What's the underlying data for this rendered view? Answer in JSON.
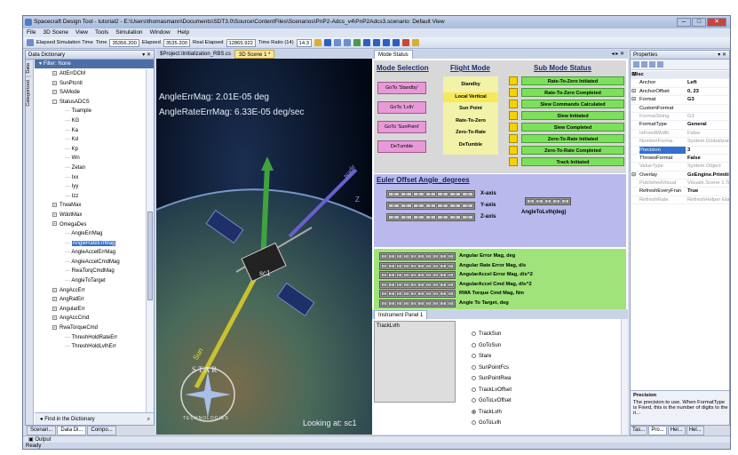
{
  "window": {
    "title": "Spacecraft Design Tool - tutorial2 - E:\\Users\\thomasmann\\Documents\\SDT3.0\\Source\\ContentFiles\\Scenarios\\PnP2-Adcs_v4\\PnP2Adcs3.scenario: Default View"
  },
  "menu": [
    "File",
    "3D Scene",
    "View",
    "Tools",
    "Simulation",
    "Window",
    "Help"
  ],
  "toolbar": {
    "elapsed_label": "Elapsed Simulation Time",
    "time_label": "Time",
    "time_value": "35356.200",
    "elapsed2_label": "Elapsed",
    "elapsed2_value": "3535.200",
    "real_label": "Real Elapsed",
    "real_value": "12865.922",
    "ratio_label": "Time Ratio (14)",
    "ratio_value": "14.3"
  },
  "data_dictionary": {
    "title": "Data Dictionary",
    "side_tabs": [
      "Data",
      "Categorized"
    ],
    "filter": "Filter: None",
    "items": [
      {
        "label": "AttErrDCM",
        "indent": 2,
        "pm": "+"
      },
      {
        "label": "SunPtcntl",
        "indent": 2,
        "pm": "+"
      },
      {
        "label": "SAMode",
        "indent": 2,
        "pm": "+"
      },
      {
        "label": "StatusADCS",
        "indent": 2,
        "pm": "-"
      },
      {
        "label": "Tsample",
        "indent": 3
      },
      {
        "label": "KG",
        "indent": 3
      },
      {
        "label": "Ka",
        "indent": 3
      },
      {
        "label": "Kd",
        "indent": 3
      },
      {
        "label": "Kp",
        "indent": 3
      },
      {
        "label": "Wn",
        "indent": 3
      },
      {
        "label": "Zetan",
        "indent": 3
      },
      {
        "label": "Ixx",
        "indent": 3
      },
      {
        "label": "Iyy",
        "indent": 3
      },
      {
        "label": "Izz",
        "indent": 3
      },
      {
        "label": "TrwaMax",
        "indent": 2,
        "pm": "+"
      },
      {
        "label": "WdotMax",
        "indent": 2,
        "pm": "+"
      },
      {
        "label": "OmegaDes",
        "indent": 2,
        "pm": "+"
      },
      {
        "label": "AngleErrMag",
        "indent": 3
      },
      {
        "label": "AngleRateErrMag",
        "indent": 3,
        "selected": true
      },
      {
        "label": "AngleAccelErrMag",
        "indent": 3
      },
      {
        "label": "AngleAccelCmdMag",
        "indent": 3
      },
      {
        "label": "RwaTorqCmdMag",
        "indent": 3
      },
      {
        "label": "AngleToTarget",
        "indent": 3
      },
      {
        "label": "AngAccErr",
        "indent": 2,
        "pm": "+"
      },
      {
        "label": "AngRatErr",
        "indent": 2,
        "pm": "+"
      },
      {
        "label": "AngularErr",
        "indent": 2,
        "pm": "+"
      },
      {
        "label": "AngAccCmd",
        "indent": 2,
        "pm": "+"
      },
      {
        "label": "RwaTorqueCmd",
        "indent": 2,
        "pm": "+"
      },
      {
        "label": "ThreshHoldRateErr",
        "indent": 3
      },
      {
        "label": "ThreshHoldLvlhErr",
        "indent": 3
      }
    ],
    "find_label": "Find in the Dictionary"
  },
  "doc_tabs": [
    "$Project.\\Initialization_RBS.cs",
    "3D Scene 1 *"
  ],
  "scene": {
    "angle_err": "AngleErrMag: 2.01E-05 deg",
    "angle_rate_err": "AngleRateErrMag: 6.33E-05 deg/sec",
    "looking_at": "Looking at: sc1",
    "label_sun": "Sun",
    "label_nadir": "Nadir",
    "logo_top": "STAR",
    "logo_bottom": "TECHNOLOGIES",
    "body_label": "sc1",
    "axis_z": "Z"
  },
  "mode_status": {
    "tab": "Mode Status",
    "mode_selection_title": "Mode Selection",
    "flight_mode_title": "Flight Mode",
    "sub_mode_title": "Sub Mode Status",
    "mode_buttons": [
      "GoTo 'Standby'",
      "GoTo 'Lvlh'",
      "GoTo 'SunPoint'",
      "DeTumble"
    ],
    "flight_modes": [
      "Standby",
      "Local Vertical",
      "Sun Point",
      "Rate-To-Zero",
      "Zero-To-Rate",
      "DeTumble"
    ],
    "flight_mode_active": 1,
    "sub_modes": [
      "Rate-To-Zero Initiated",
      "Rate-To-Zero Completed",
      "Slew Commands Calculated",
      "Slew Initiated",
      "Slew Completed",
      "Zero-To-Rate Initiated",
      "Zero-To-Rate Completed",
      "Track Initiated"
    ],
    "euler_title": "Euler Offset Angle_degrees",
    "axes": [
      "X-axis",
      "Y-axis",
      "Z-axis"
    ],
    "angle_to_lvlh": "AngleToLvlh(deg)",
    "magnitudes": [
      "Angular Error Mag, deg",
      "Angular Rate Error Mag, d/s",
      "AngularAccel Error Mag, d/s^2",
      "AngularAccel Cmd Mag, d/s^2",
      "RWA Torque Cmd Mag, Nm",
      "Angle To Target, deg"
    ]
  },
  "instrument_panel": {
    "tab": "Instrument Panel 1",
    "box_label": "TrackLvlh",
    "options": [
      "TrackSun",
      "GoToSun",
      "Stare",
      "SunPointFcs",
      "SunPointRwa",
      "TrackLvOffset",
      "GoToLvOffset",
      "TrackLvlh",
      "GoToLvlh"
    ],
    "selected": "TrackLvlh"
  },
  "properties": {
    "title": "Properties",
    "rows": [
      {
        "name": "Misc",
        "cat": true
      },
      {
        "name": "Anchor",
        "value": "Left"
      },
      {
        "name": "AnchorOffset",
        "value": "0, 23",
        "exp": true
      },
      {
        "name": "Format",
        "value": "G3",
        "exp": true
      },
      {
        "name": "CustomFormat",
        "value": ""
      },
      {
        "name": "FormatString",
        "value": "G3",
        "gray": true
      },
      {
        "name": "FormatType",
        "value": "General"
      },
      {
        "name": "IsFixedWidth",
        "value": "False",
        "gray": true
      },
      {
        "name": "NumberForma",
        "value": "System.Globalization.Num",
        "gray": true
      },
      {
        "name": "Precision",
        "value": "3",
        "selected": true
      },
      {
        "name": "ThrowsFormat",
        "value": "False"
      },
      {
        "name": "ValueType",
        "value": "System.Object",
        "gray": true
      },
      {
        "name": "Overlay",
        "value": "GxEngine.Primitives.TextC",
        "exp": true
      },
      {
        "name": "PublishedVisual",
        "value": "Visuals.Scene 1.TextOve",
        "gray": true
      },
      {
        "name": "RefreshEveryFran",
        "value": "True"
      },
      {
        "name": "RefreshRate",
        "value": "RefreshHelper ElapsedWa",
        "gray": true
      }
    ],
    "desc_title": "Precision",
    "desc_text": "The precision to use. When FormatType is Fixed, this is the number of digits to the ri..."
  },
  "bottom_tabs_left": [
    "Scenari...",
    "Data Di...",
    "Compo..."
  ],
  "bottom_tabs_right": [
    "Tas...",
    "Pro...",
    "Hel...",
    "Hel..."
  ],
  "output_label": "Output",
  "status": "Ready"
}
